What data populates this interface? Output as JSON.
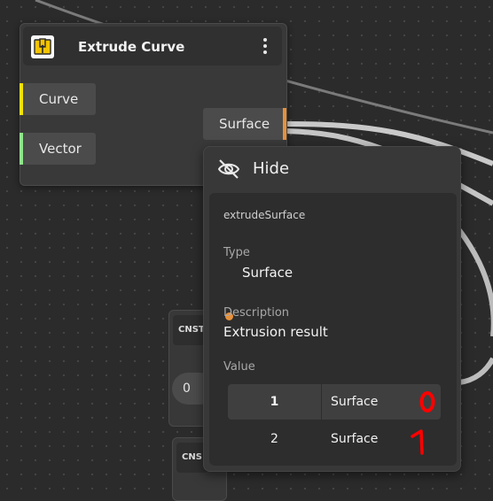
{
  "node": {
    "title": "Extrude Curve",
    "icon": "book-icon",
    "inputs": [
      {
        "label": "Curve",
        "color": "#f5e100"
      },
      {
        "label": "Vector",
        "color": "#8ee58a"
      }
    ],
    "output": {
      "label": "Surface",
      "color": "#e8913a"
    }
  },
  "background_nodes": [
    {
      "label": "CNST",
      "value": "0"
    },
    {
      "label": "CNS"
    }
  ],
  "popup": {
    "hide_label": "Hide",
    "name": "extrudeSurface",
    "type_label": "Type",
    "type_value": "Surface",
    "type_color": "#e8913a",
    "description_label": "Description",
    "description_value": "Extrusion result",
    "value_label": "Value",
    "values": [
      {
        "index": "1",
        "type": "Surface",
        "selected": true
      },
      {
        "index": "2",
        "type": "Surface",
        "selected": false
      }
    ]
  },
  "annotations": [
    {
      "text": "0",
      "color": "#ff0000"
    },
    {
      "text": "1",
      "color": "#ff0000"
    }
  ]
}
